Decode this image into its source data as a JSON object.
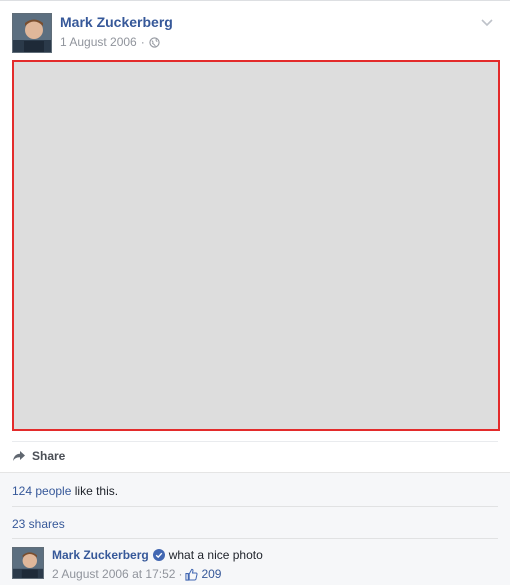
{
  "post": {
    "author": "Mark Zuckerberg",
    "date": "1 August 2006",
    "separator": "·",
    "privacy_icon": "globe-icon",
    "menu_icon": "chevron-down-icon"
  },
  "actions": {
    "share_label": "Share"
  },
  "ufi": {
    "likes_link": "124 people",
    "likes_suffix": "like this.",
    "shares": "23 shares"
  },
  "comment": {
    "author": "Mark Zuckerberg",
    "text": "what a nice photo",
    "timestamp": "2 August 2006 at 17:52",
    "separator": "·",
    "like_count": "209"
  },
  "colors": {
    "link": "#365899",
    "photo_border": "#e32b2b",
    "photo_fill": "#dddddd",
    "meta": "#90949c"
  }
}
